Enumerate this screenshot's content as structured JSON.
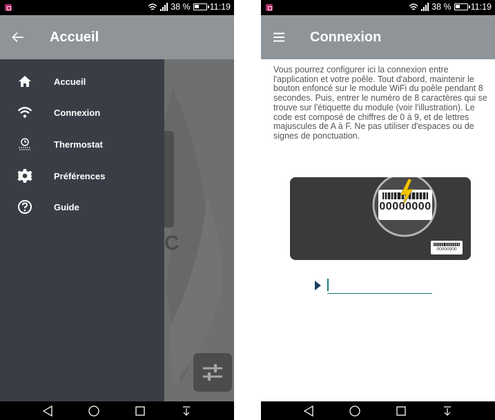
{
  "left_screen": {
    "status": {
      "battery_percent": "38 %",
      "time": "11:19"
    },
    "appbar": {
      "title": "Accueil",
      "back_icon": "arrow-back-icon"
    },
    "drawer": {
      "items": [
        {
          "label": "Accueil",
          "icon": "home-icon"
        },
        {
          "label": "Connexion",
          "icon": "wifi-icon"
        },
        {
          "label": "Thermostat",
          "icon": "thermostat-icon"
        },
        {
          "label": "Préférences",
          "icon": "gear-icon"
        },
        {
          "label": "Guide",
          "icon": "help-icon"
        }
      ]
    },
    "background_letter": "C"
  },
  "right_screen": {
    "status": {
      "battery_percent": "38 %",
      "time": "11:19"
    },
    "appbar": {
      "title": "Connexion",
      "menu_icon": "menu-icon"
    },
    "instructions": "Vous pourrez configurer ici la connexion entre l'application et votre poêle. Tout d'abord, maintenir le bouton enfoncé sur le module WiFi du poêle pendant 8 secondes. Puis, entrer le numéro de 8 caractères qui se trouve sur l'étiquette du module (voir l'illustration). Le code est composé de chiffres de 0 à 9, et de lettres majuscules de A à F. Ne pas utiliser d'espaces ou de signes de ponctuation.",
    "illustration": {
      "zoom_code": "00000000",
      "small_code": "00000000"
    },
    "code_input": {
      "value": "",
      "placeholder": ""
    }
  },
  "colors": {
    "appbar": "#8f9498",
    "drawer": "#393e46",
    "accent": "#1b7a7a",
    "flash": "#f5c400"
  }
}
